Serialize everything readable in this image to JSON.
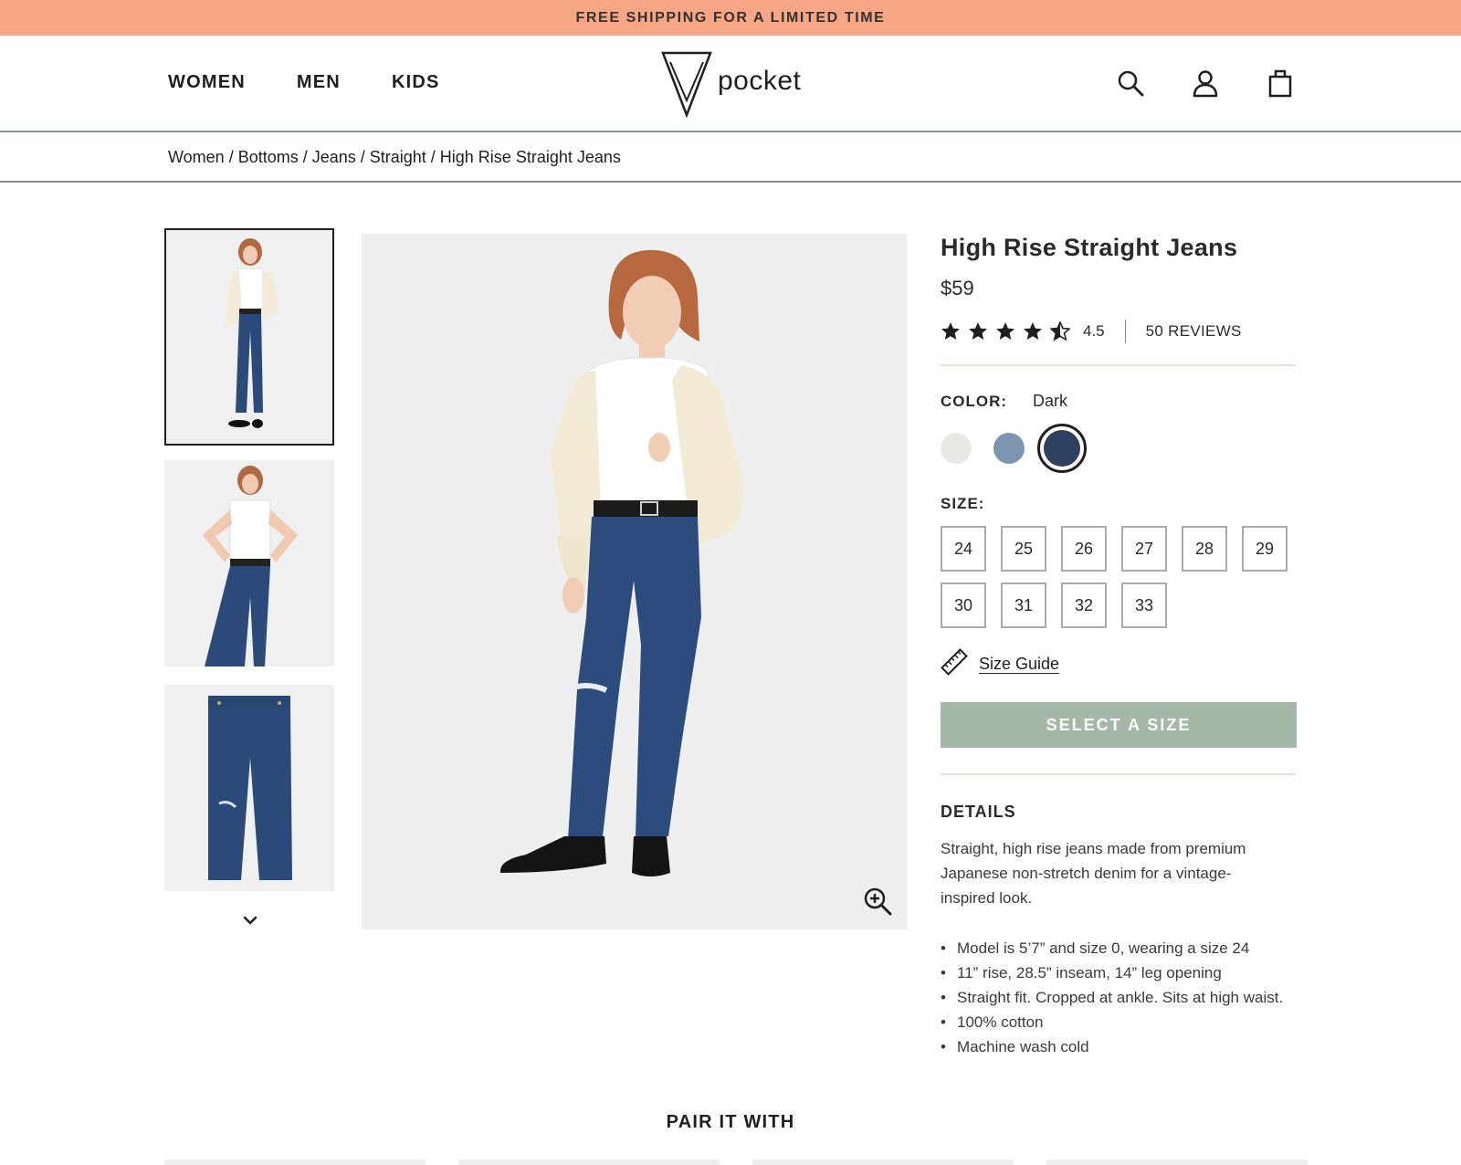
{
  "promo": {
    "text": "FREE SHIPPING FOR A LIMITED TIME"
  },
  "nav": {
    "items": [
      "WOMEN",
      "MEN",
      "KIDS"
    ]
  },
  "brand": {
    "name": "pocket"
  },
  "header_icons": [
    "search-icon",
    "account-icon",
    "bag-icon"
  ],
  "breadcrumb": {
    "text": "Women / Bottoms / Jeans / Straight / High Rise Straight Jeans"
  },
  "product": {
    "title": "High Rise Straight Jeans",
    "price": "$59",
    "rating": "4.5",
    "rating_value": 4.5,
    "reviews": "50 REVIEWS"
  },
  "color": {
    "label": "COLOR:",
    "selected": "Dark",
    "swatches": [
      "#e9e8e5",
      "#7d95b1",
      "#2f3f5e"
    ]
  },
  "size": {
    "label": "SIZE:",
    "options": [
      "24",
      "25",
      "26",
      "27",
      "28",
      "29",
      "30",
      "31",
      "32",
      "33"
    ],
    "guide": "Size Guide"
  },
  "cta": {
    "label": "SELECT A SIZE"
  },
  "details": {
    "title": "DETAILS",
    "text": "Straight, high rise jeans made from premium Japanese non-stretch denim for a vintage-inspired look.",
    "bullets": [
      "Model is 5’7” and size 0, wearing a size 24",
      "11” rise, 28.5” inseam, 14” leg opening",
      "Straight fit. Cropped at ankle. Sits at high waist.",
      "100% cotton",
      "Machine wash cold"
    ]
  },
  "pair": {
    "title": "PAIR IT WITH"
  },
  "colors": {
    "promo_bg": "#f6a585",
    "accent_green": "#a3b8a7",
    "divider": "#7d9483"
  }
}
